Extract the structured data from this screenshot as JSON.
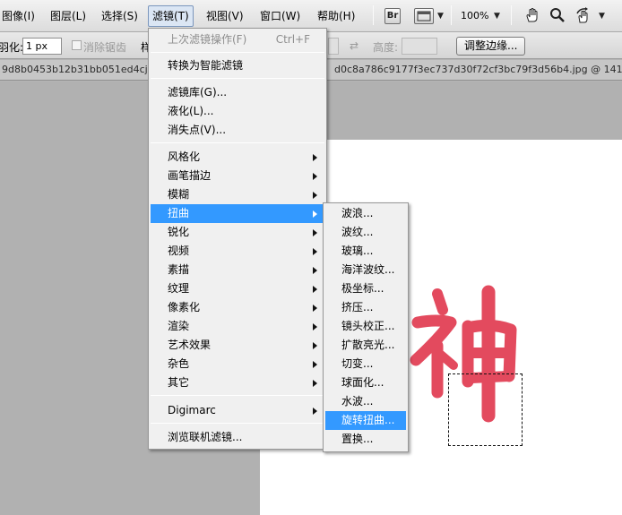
{
  "menubar": {
    "items": [
      "图像(I)",
      "图层(L)",
      "选择(S)",
      "滤镜(T)",
      "视图(V)",
      "窗口(W)",
      "帮助(H)"
    ],
    "active": "滤镜(T)",
    "bridge_icon": "Br",
    "zoom": "100%",
    "icons": [
      "bridge-icon",
      "screen-mode-icon",
      "hand-icon",
      "zoom-icon",
      "rotate-view-icon"
    ]
  },
  "options": {
    "feather_label": "羽化:",
    "feather_value": "1 px",
    "antialias_label": "消除锯齿",
    "style_label": "样",
    "height_label": "高度:",
    "refine_edge_button": "调整边缘..."
  },
  "tabs": {
    "left_title": "9d8b0453b12b31bb051ed4cjpg",
    "right_title": "d0c8a786c9177f3ec737d30f72cf3bc79f3d56b4.jpg @ 141% (F"
  },
  "filter_menu": {
    "last_filter": "上次滤镜操作(F)",
    "last_filter_shortcut": "Ctrl+F",
    "convert_smart": "转换为智能滤镜",
    "gallery": "滤镜库(G)...",
    "liquify": "液化(L)...",
    "vanishing_point": "消失点(V)...",
    "groups": [
      "风格化",
      "画笔描边",
      "模糊",
      "扭曲",
      "锐化",
      "视频",
      "素描",
      "纹理",
      "像素化",
      "渲染",
      "艺术效果",
      "杂色",
      "其它"
    ],
    "highlighted": "扭曲",
    "digimarc": "Digimarc",
    "browse_online": "浏览联机滤镜..."
  },
  "distort_submenu": {
    "items": [
      "波浪...",
      "波纹...",
      "玻璃...",
      "海洋波纹...",
      "极坐标...",
      "挤压...",
      "镜头校正...",
      "扩散亮光...",
      "切变...",
      "球面化...",
      "水波...",
      "旋转扭曲...",
      "置换..."
    ],
    "highlighted": "旋转扭曲..."
  },
  "colors": {
    "highlight": "#3399ff",
    "artwork": "#e34a5e"
  }
}
